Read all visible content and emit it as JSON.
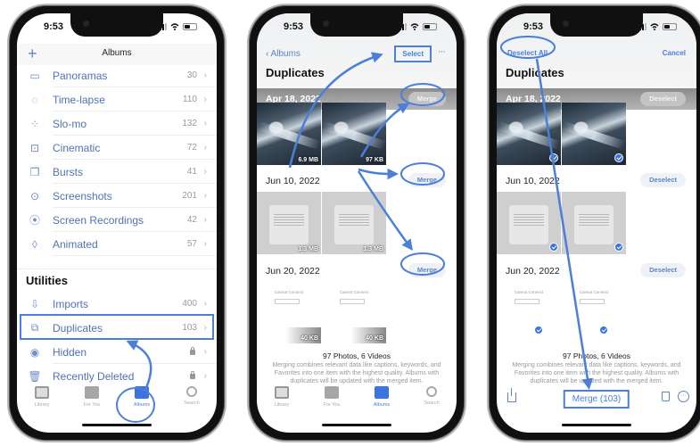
{
  "status_bar": {
    "time": "9:53"
  },
  "phone1": {
    "nav_title": "Albums",
    "add_symbol": "+",
    "media_types": [
      {
        "icon": "panorama-icon",
        "glyph": "▭",
        "label": "Panoramas",
        "count": "30"
      },
      {
        "icon": "timelapse-icon",
        "glyph": "◌",
        "label": "Time-lapse",
        "count": "110"
      },
      {
        "icon": "slomo-icon",
        "glyph": "⁘",
        "label": "Slo-mo",
        "count": "132"
      },
      {
        "icon": "cinematic-icon",
        "glyph": "⊡",
        "label": "Cinematic",
        "count": "72"
      },
      {
        "icon": "bursts-icon",
        "glyph": "❒",
        "label": "Bursts",
        "count": "41"
      },
      {
        "icon": "screenshot-icon",
        "glyph": "⊙",
        "label": "Screenshots",
        "count": "201"
      },
      {
        "icon": "screen-recording-icon",
        "glyph": "⦿",
        "label": "Screen Recordings",
        "count": "42"
      },
      {
        "icon": "animated-icon",
        "glyph": "◊",
        "label": "Animated",
        "count": "57"
      }
    ],
    "utilities_title": "Utilities",
    "utilities": [
      {
        "icon": "import-icon",
        "glyph": "⇩",
        "label": "Imports",
        "count": "400",
        "locked": false
      },
      {
        "icon": "duplicates-icon",
        "glyph": "⧉",
        "label": "Duplicates",
        "count": "103",
        "locked": false,
        "highlighted": true
      },
      {
        "icon": "hidden-eye-icon",
        "glyph": "◉",
        "label": "Hidden",
        "count": "",
        "locked": true
      },
      {
        "icon": "trash-icon",
        "glyph": "🗑",
        "label": "Recently Deleted",
        "count": "",
        "locked": true
      }
    ],
    "chevron": "›"
  },
  "tabbar": {
    "tabs": [
      {
        "label": "Library",
        "icon": "library-icon",
        "active": false
      },
      {
        "label": "For You",
        "icon": "for-you-icon",
        "active": false
      },
      {
        "label": "Albums",
        "icon": "albums-icon",
        "active": true
      },
      {
        "label": "Search",
        "icon": "search-icon",
        "active": false
      }
    ]
  },
  "phone2": {
    "back_label": "‹ Albums",
    "select_label": "Select",
    "more_label": "···",
    "title": "Duplicates",
    "groups": [
      {
        "date": "Apr 18, 2022",
        "action": "Merge",
        "sizes": [
          "6.9 MB",
          "97 KB"
        ]
      },
      {
        "date": "Jun 10, 2022",
        "action": "Merge",
        "sizes": [
          "1.3 MB",
          "1.3 MB"
        ]
      },
      {
        "date": "Jun 20, 2022",
        "action": "Merge",
        "sizes": [
          "40 KB",
          "40 KB"
        ],
        "thumb_text": "Cannot Connect"
      }
    ],
    "summary_count": "97 Photos, 6 Videos",
    "summary_text": "Merging combines relevant data like captions, keywords, and Favorites into one item with the highest quality. Albums with duplicates will be updated with the merged item."
  },
  "phone3": {
    "deselect_all_label": "Deselect All",
    "cancel_label": "Cancel",
    "title": "Duplicates",
    "groups": [
      {
        "date": "Apr 18, 2022",
        "action": "Deselect"
      },
      {
        "date": "Jun 10, 2022",
        "action": "Deselect"
      },
      {
        "date": "Jun 20, 2022",
        "action": "Deselect",
        "thumb_text": "Cannot Connect"
      }
    ],
    "summary_count": "97 Photos, 6 Videos",
    "summary_text": "Merging combines relevant data like captions, keywords, and Favorites into one item with the highest quality. Albums with duplicates will be updated with the merged item.",
    "merge_button_label": "Merge (103)"
  },
  "colors": {
    "accent": "#4b7fd8",
    "annotation": "#4b7fd8",
    "label_blue": "#4f73b6"
  }
}
